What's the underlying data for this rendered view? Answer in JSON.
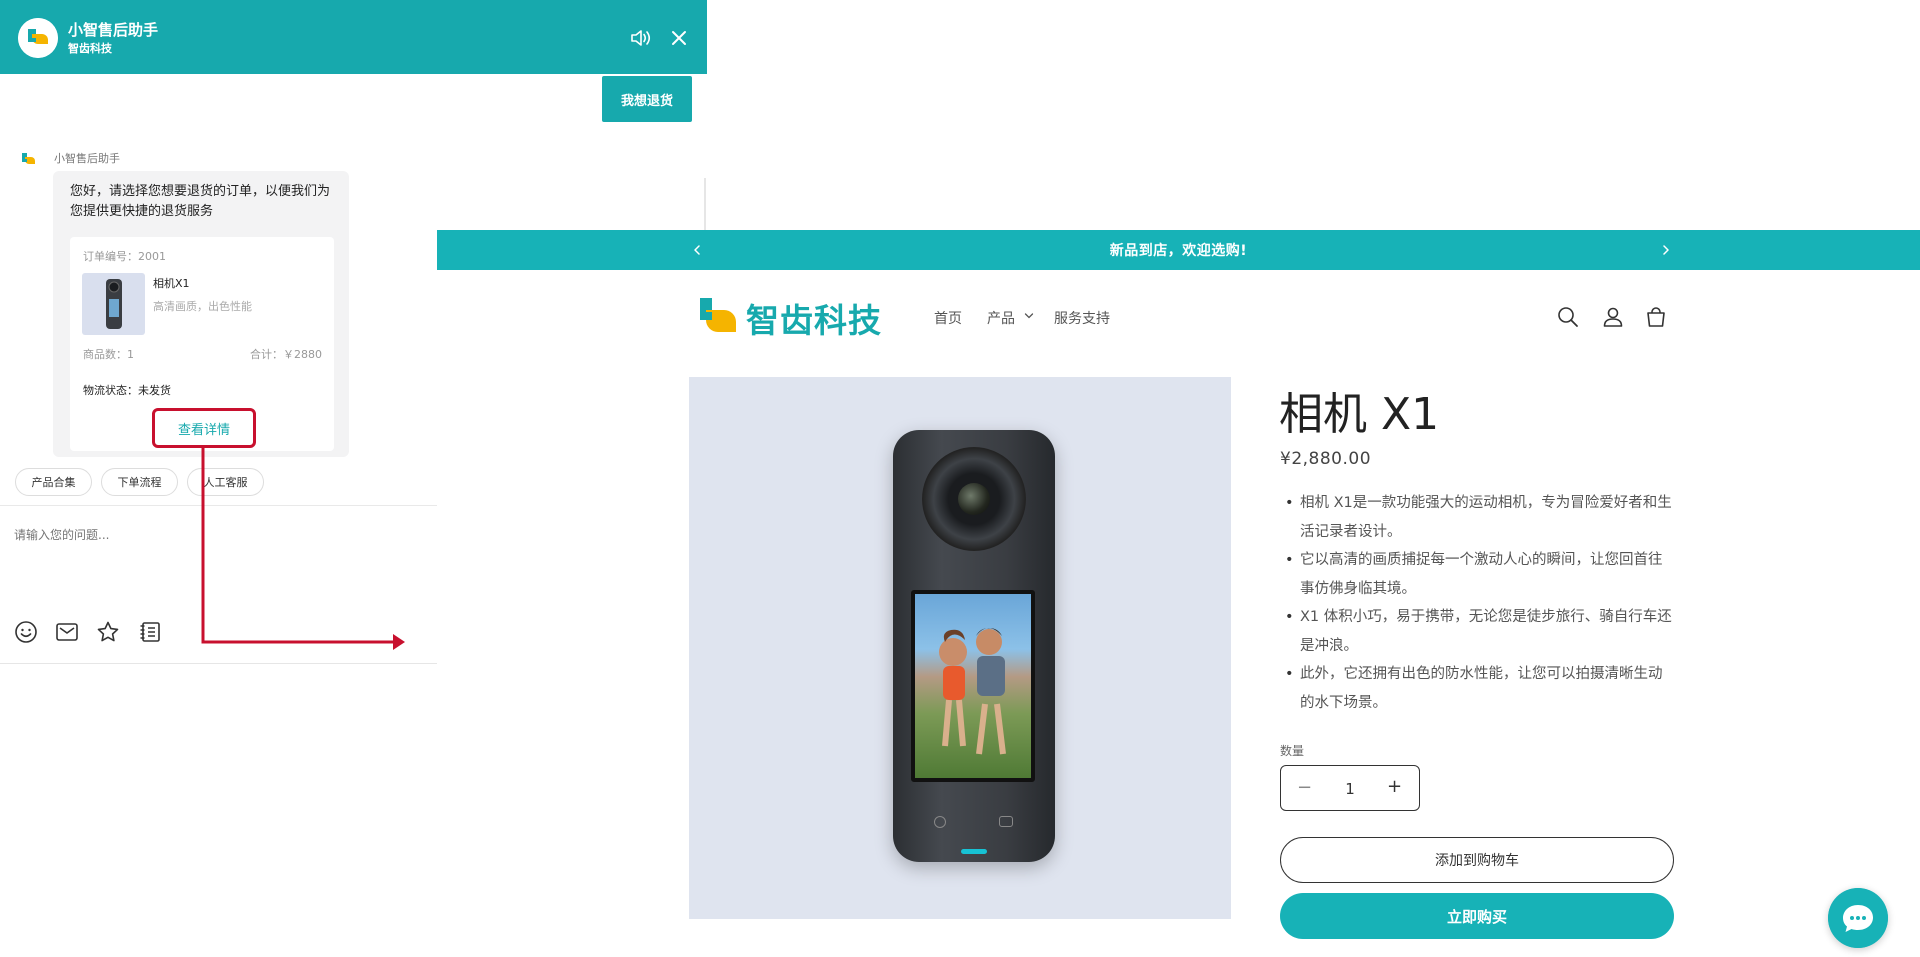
{
  "chat": {
    "title": "小智售后助手",
    "subtitle": "智齿科技",
    "user_message": "我想退货",
    "bot_name": "小智售后助手",
    "bot_message": "您好，请选择您想要退货的订单，以便我们为您提供更快捷的退货服务",
    "order": {
      "number": "订单编号：2001",
      "product_name": "相机X1",
      "product_desc": "高清画质，出色性能",
      "count": "商品数：1",
      "total": "合计：￥2880",
      "status": "物流状态：未发货",
      "detail_button": "查看详情"
    },
    "quick_replies": [
      "产品合集",
      "下单流程",
      "人工客服"
    ],
    "input_placeholder": "请输入您的问题...",
    "tools": [
      "emoji-icon",
      "mail-icon",
      "star-icon",
      "notes-icon"
    ]
  },
  "store": {
    "announcement": "新品到店，欢迎选购!",
    "brand": "智齿科技",
    "nav": {
      "home": "首页",
      "products": "产品",
      "support": "服务支持"
    },
    "product": {
      "title": "相机 X1",
      "price": "¥2,880.00",
      "description": [
        "相机 X1是一款功能强大的运动相机，专为冒险爱好者和生活记录者设计。",
        "它以高清的画质捕捉每一个激动人心的瞬间，让您回首往事仿佛身临其境。",
        "X1 体积小巧，易于携带，无论您是徒步旅行、骑自行车还是冲浪。",
        "此外，它还拥有出色的防水性能，让您可以拍摄清晰生动的水下场景。"
      ],
      "quantity_label": "数量",
      "quantity": "1",
      "minus": "−",
      "plus": "+",
      "add_to_cart": "添加到购物车",
      "buy_now": "立即购买"
    }
  },
  "colors": {
    "accent": "#17b2b7",
    "header": "#17a9ad",
    "highlight": "#c8102e"
  }
}
